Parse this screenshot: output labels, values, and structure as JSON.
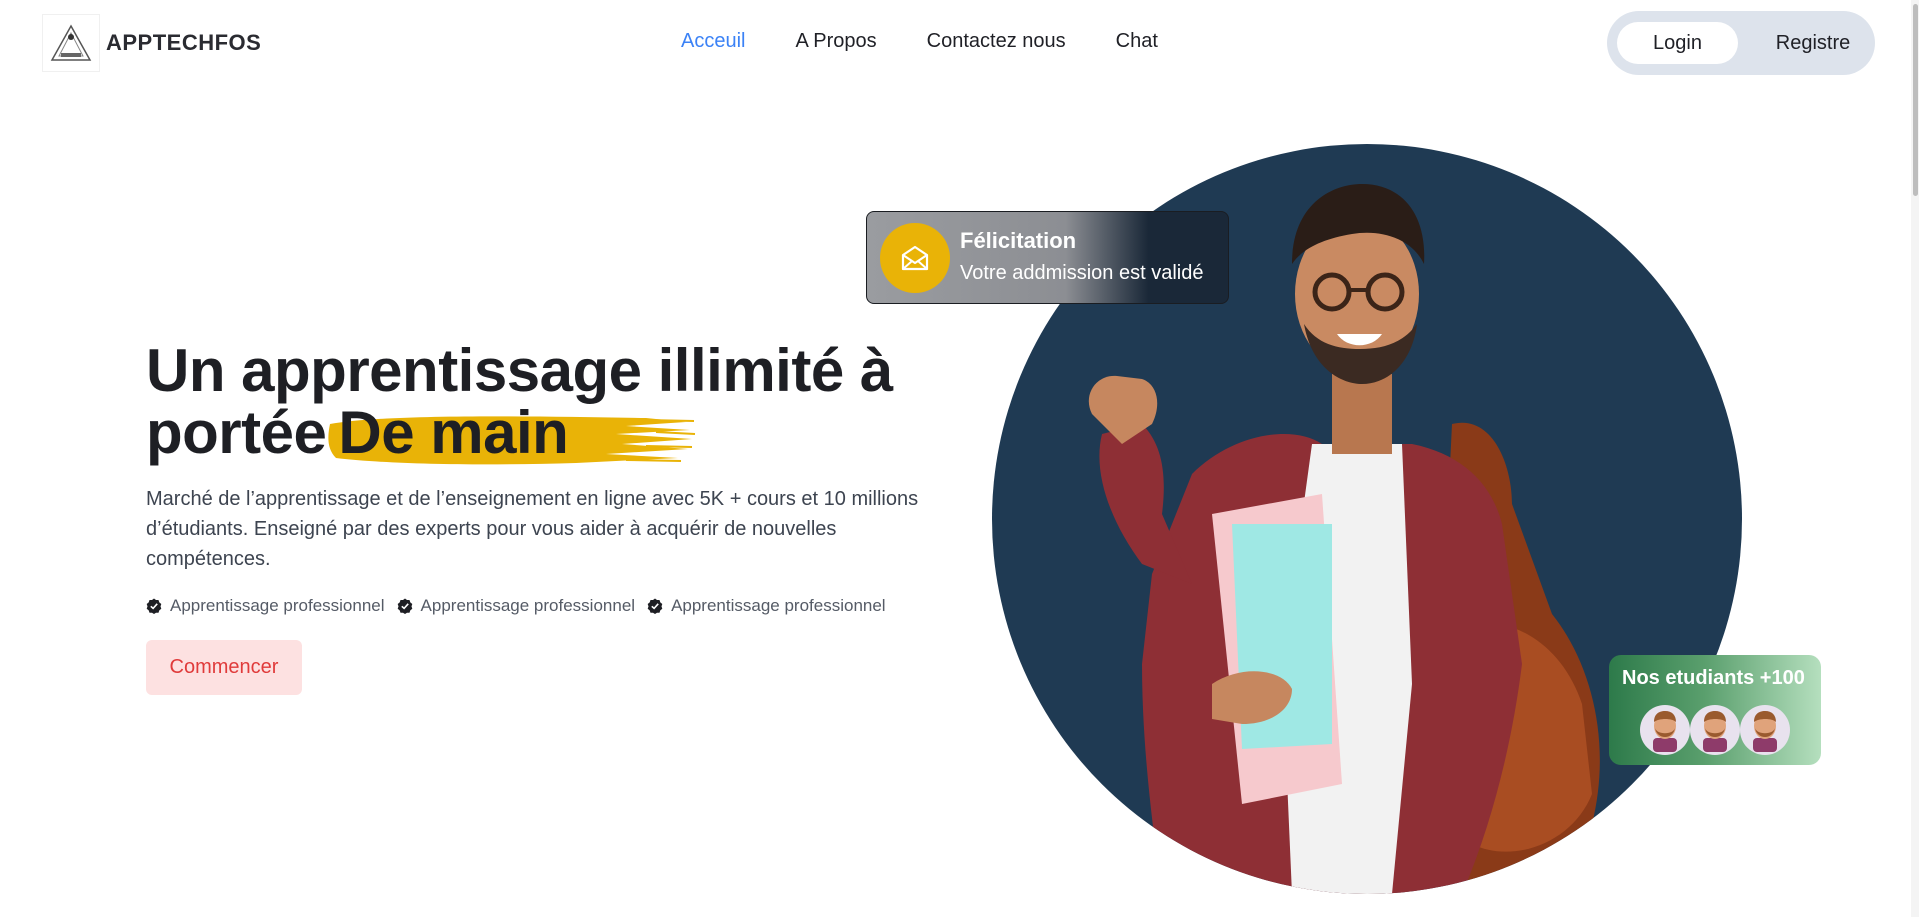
{
  "brand": {
    "name": "APPTECHFOS",
    "logo_small_text": "APPTECHFOS"
  },
  "nav": {
    "items": [
      {
        "label": "Acceuil",
        "active": true
      },
      {
        "label": "A Propos",
        "active": false
      },
      {
        "label": "Contactez nous",
        "active": false
      },
      {
        "label": "Chat",
        "active": false
      }
    ]
  },
  "auth": {
    "login_label": "Login",
    "register_label": "Registre"
  },
  "hero": {
    "headline_line1": "Un apprentissage illimité à",
    "headline_line2_prefix": "portée",
    "headline_highlight": "De main",
    "description": "Marché de l’apprentissage et de l’enseignement en ligne avec 5K + cours et 10 millions d’étudiants. Enseigné par des experts pour vous aider à acquérir de nouvelles compétences.",
    "features": [
      "Apprentissage professionnel",
      "Apprentissage professionnel",
      "Apprentissage professionnel"
    ],
    "cta_label": "Commencer"
  },
  "congrats_card": {
    "title": "Félicitation",
    "subtitle": "Votre addmission est validé",
    "icon": "envelope-open-icon"
  },
  "students_card": {
    "title": "Nos etudiants +100",
    "avatar_count": 3
  },
  "colors": {
    "accent_nav": "#3b82f6",
    "highlight_brush": "#e9b307",
    "hero_circle": "#1f3a53",
    "cta_bg": "#fde1e1",
    "cta_text": "#e03b3b",
    "students_card": "#5a9f6d"
  }
}
